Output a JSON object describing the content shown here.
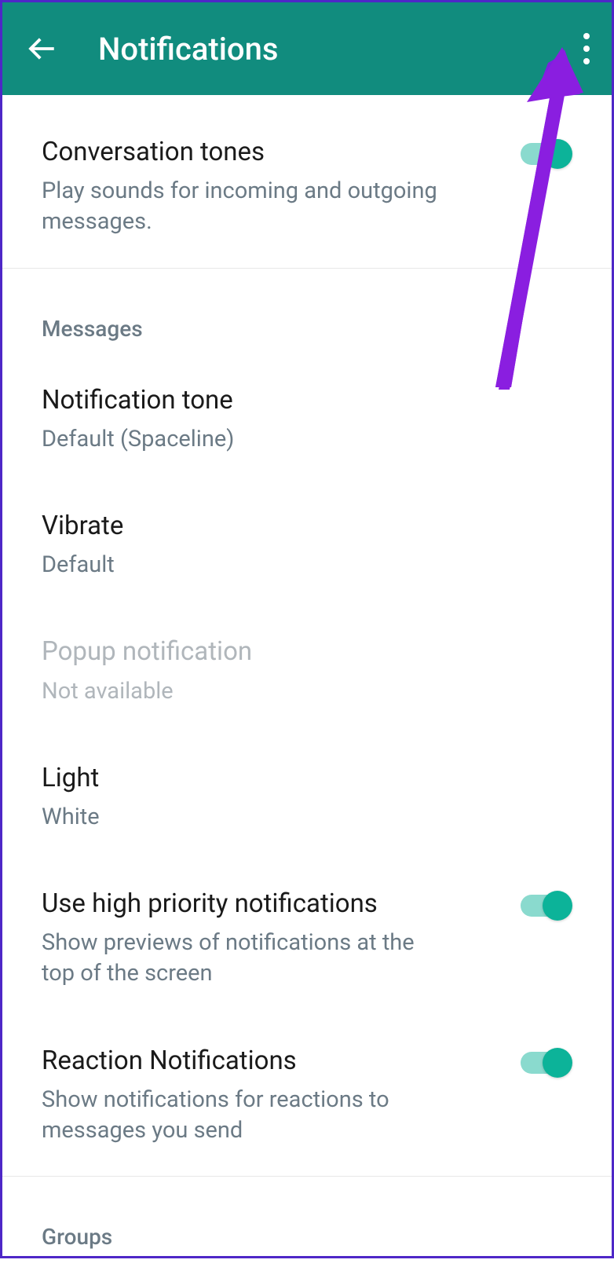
{
  "header": {
    "title": "Notifications"
  },
  "sections": {
    "top": {
      "conversation_tones": {
        "title": "Conversation tones",
        "subtitle": "Play sounds for incoming and outgoing messages."
      }
    },
    "messages": {
      "header": "Messages",
      "notification_tone": {
        "title": "Notification tone",
        "subtitle": "Default (Spaceline)"
      },
      "vibrate": {
        "title": "Vibrate",
        "subtitle": "Default"
      },
      "popup": {
        "title": "Popup notification",
        "subtitle": "Not available"
      },
      "light": {
        "title": "Light",
        "subtitle": "White"
      },
      "high_priority": {
        "title": "Use high priority notifications",
        "subtitle": "Show previews of notifications at the top of the screen"
      },
      "reaction": {
        "title": "Reaction Notifications",
        "subtitle": "Show notifications for reactions to messages you send"
      }
    },
    "groups": {
      "header": "Groups"
    }
  }
}
